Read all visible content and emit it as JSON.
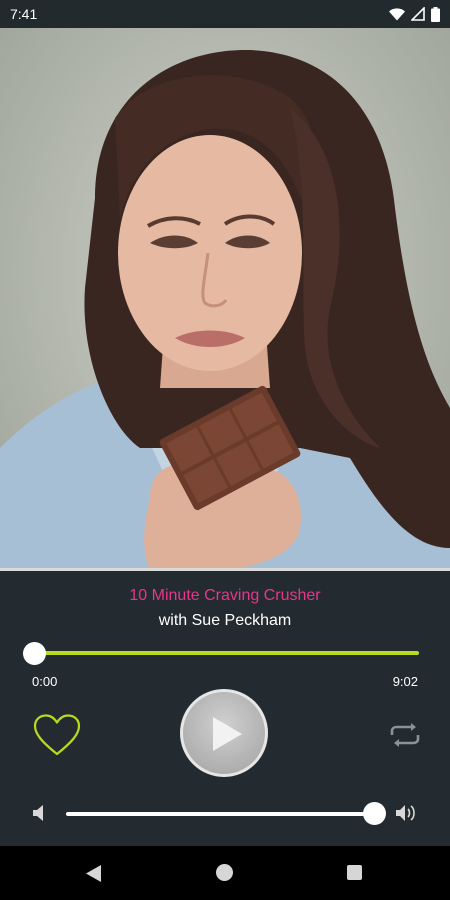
{
  "status_bar": {
    "time": "7:41",
    "icons": [
      "wifi-icon",
      "signal-icon",
      "battery-icon"
    ]
  },
  "artwork": {
    "description_icon": "cover-art-image"
  },
  "player": {
    "title": "10 Minute Craving Crusher",
    "artist": "with Sue Peckham",
    "current_time": "0:00",
    "total_time": "9:02",
    "progress": 0.0,
    "volume": 1.0,
    "colors": {
      "title": "#e8358d",
      "accent": "#b7dc1e",
      "background": "#232b30"
    },
    "icons": {
      "like": "heart-icon",
      "play": "play-icon",
      "repeat": "repeat-icon",
      "volume_low": "volume-low-icon",
      "volume_high": "volume-high-icon"
    }
  },
  "nav_bar": {
    "icons": [
      "back-icon",
      "home-icon",
      "recents-icon"
    ]
  }
}
